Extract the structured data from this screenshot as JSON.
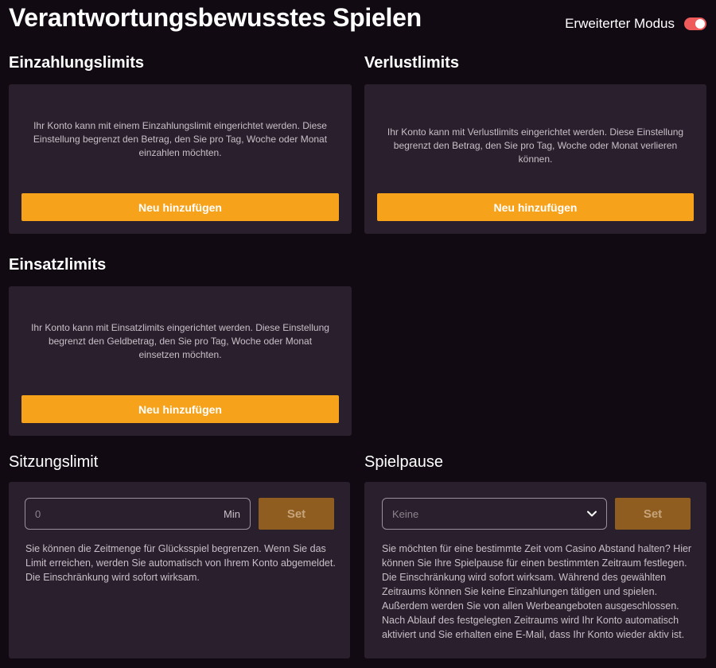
{
  "header": {
    "title": "Verantwortungsbewusstes Spielen",
    "mode_label": "Erweiterter Modus",
    "mode_enabled": true
  },
  "deposit": {
    "title": "Einzahlungslimits",
    "description": "Ihr Konto kann mit einem Einzahlungslimit eingerichtet werden. Diese Einstellung begrenzt den Betrag, den Sie pro Tag, Woche oder Monat einzahlen möchten.",
    "button": "Neu hinzufügen"
  },
  "loss": {
    "title": "Verlustlimits",
    "description": "Ihr Konto kann mit Verlustlimits eingerichtet werden. Diese Einstellung begrenzt den Betrag, den Sie pro Tag, Woche oder Monat verlieren können.",
    "button": "Neu hinzufügen"
  },
  "wager": {
    "title": "Einsatzlimits",
    "description": "Ihr Konto kann mit Einsatzlimits eingerichtet werden. Diese Einstellung begrenzt den Geldbetrag, den Sie pro Tag, Woche oder Monat einsetzen möchten.",
    "button": "Neu hinzufügen"
  },
  "session": {
    "title": "Sitzungslimit",
    "input_placeholder": "0",
    "unit": "Min",
    "button": "Set",
    "description": "Sie können die Zeitmenge für Glücksspiel begrenzen. Wenn Sie das Limit erreichen, werden Sie automatisch von Ihrem Konto abgemeldet. Die Einschränkung wird sofort wirksam."
  },
  "pause": {
    "title": "Spielpause",
    "selected": "Keine",
    "button": "Set",
    "description": "Sie möchten für eine bestimmte Zeit vom Casino Abstand halten? Hier können Sie Ihre Spielpause für einen bestimmten Zeitraum festlegen. Die Einschränkung wird sofort wirksam. Während des gewählten Zeitraums können Sie keine Einzahlungen tätigen und spielen. Außerdem werden Sie von allen Werbeangeboten ausgeschlossen. Nach Ablauf des festgelegten Zeitraums wird Ihr Konto automatisch aktiviert und Sie erhalten eine E-Mail, dass Ihr Konto wieder aktiv ist."
  },
  "colors": {
    "background": "#120a13",
    "card": "#2a1f2c",
    "accent": "#f7a21b",
    "set_button": "#8e5d1f",
    "toggle_on": "#ef5a5a"
  }
}
